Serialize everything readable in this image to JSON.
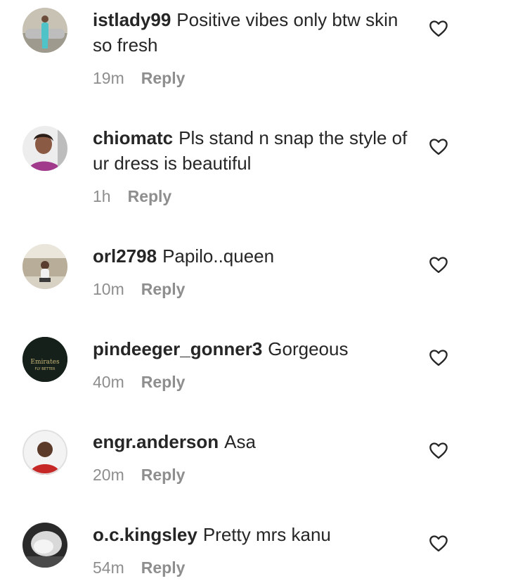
{
  "comments": [
    {
      "username": "istlady99",
      "text": "Positive vibes only btw skin so fresh",
      "time": "19m",
      "reply_label": "Reply",
      "avatar_icon": "user-avatar"
    },
    {
      "username": "chiomatc",
      "text": "Pls stand n snap the style of ur dress is beautiful",
      "time": "1h",
      "reply_label": "Reply",
      "avatar_icon": "user-avatar"
    },
    {
      "username": "orl2798",
      "text": "Papilo..queen",
      "time": "10m",
      "reply_label": "Reply",
      "avatar_icon": "user-avatar"
    },
    {
      "username": "pindeeger_gonner3",
      "text": "Gorgeous",
      "time": "40m",
      "reply_label": "Reply",
      "avatar_icon": "user-avatar",
      "avatar_text": [
        "Emirates",
        "FLY BETTER"
      ]
    },
    {
      "username": "engr.anderson",
      "text": "Asa",
      "time": "20m",
      "reply_label": "Reply",
      "avatar_icon": "user-avatar"
    },
    {
      "username": "o.c.kingsley",
      "text": "Pretty mrs kanu",
      "time": "54m",
      "reply_label": "Reply",
      "avatar_icon": "user-avatar"
    }
  ],
  "like_icon": "heart-outline-icon",
  "colors": {
    "primary_text": "#262626",
    "secondary_text": "#8e8e8e",
    "background": "#ffffff"
  }
}
